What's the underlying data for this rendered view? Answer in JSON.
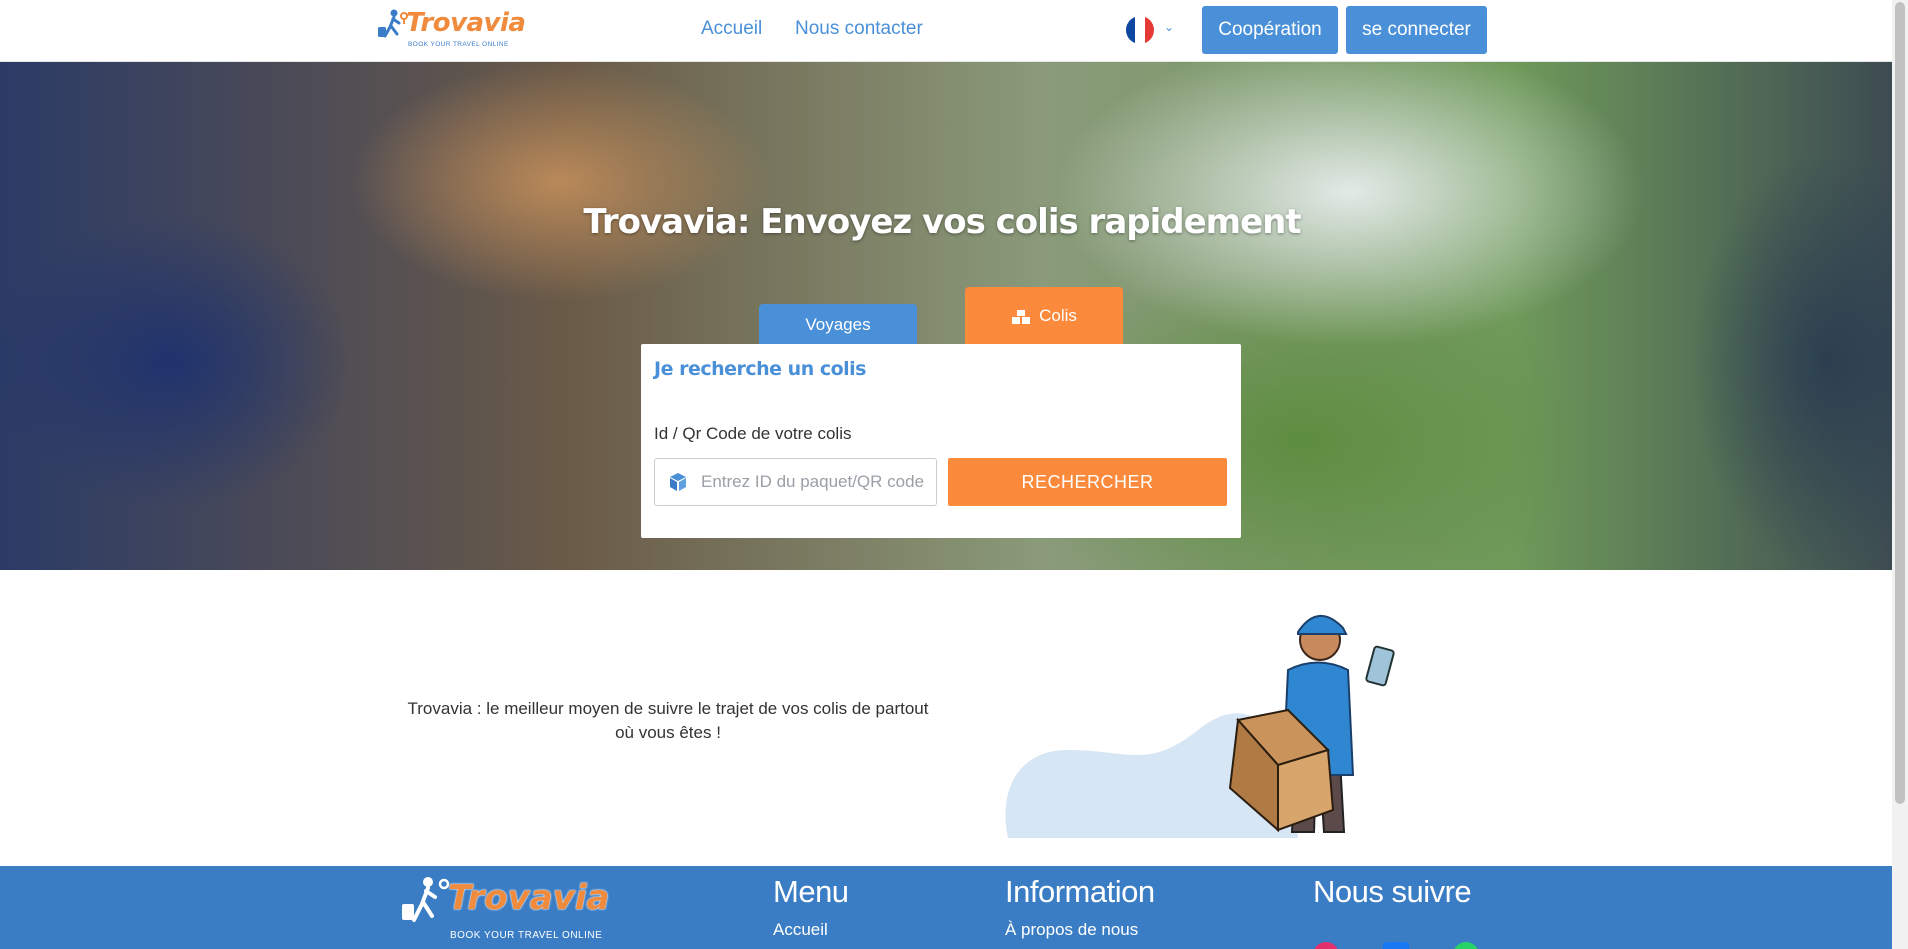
{
  "header": {
    "logo_text": "Trovavia",
    "logo_tagline": "BOOK YOUR TRAVEL ONLINE",
    "nav": [
      "Accueil",
      "Nous contacter"
    ],
    "language_flag_icon": "france-flag-icon",
    "cooperation_label": "Coopération",
    "login_label": "se connecter"
  },
  "hero": {
    "title": "Trovavia: Envoyez vos colis rapidement",
    "tabs": {
      "voyages": "Voyages",
      "colis": "Colis"
    },
    "search": {
      "title": "Je recherche un colis",
      "field_label": "Id / Qr Code de votre colis",
      "placeholder": "Entrez ID du paquet/QR code",
      "value": "",
      "button_label": "RECHERCHER"
    }
  },
  "middle": {
    "text": "Trovavia : le meilleur moyen de suivre le trajet de vos colis de partout où vous êtes !"
  },
  "footer": {
    "logo_text": "Trovavia",
    "logo_tagline": "BOOK YOUR TRAVEL ONLINE",
    "menu_heading": "Menu",
    "menu_link": "Accueil",
    "info_heading": "Information",
    "info_link": "À propos de nous",
    "follow_heading": "Nous suivre"
  },
  "colors": {
    "brand_blue": "#4a90d9",
    "brand_orange": "#fb8a3c",
    "footer_blue": "#3b7dc4"
  }
}
